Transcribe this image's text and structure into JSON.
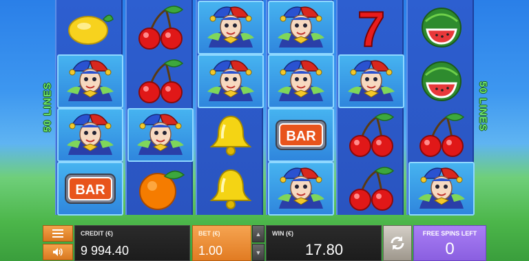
{
  "game": {
    "lines_label": "50 LINES",
    "reels": [
      [
        "lemon",
        "joker",
        "joker",
        "bar"
      ],
      [
        "cherry",
        "cherry",
        "joker",
        "orange"
      ],
      [
        "joker",
        "joker",
        "bell",
        "bell"
      ],
      [
        "joker",
        "joker",
        "bar",
        "joker"
      ],
      [
        "seven",
        "joker",
        "cherry",
        "cherry"
      ],
      [
        "watermelon",
        "watermelon",
        "cherry",
        "joker"
      ]
    ],
    "bar_text": "BAR",
    "seven_text": "7"
  },
  "controls": {
    "menu_icon": "hamburger-icon",
    "sound_icon": "speaker-icon",
    "credit_label": "CREDIT (€)",
    "credit_value": "9 994.40",
    "bet_label": "BET (€)",
    "bet_value": "1.00",
    "win_label": "WIN (€)",
    "win_value": "17.80",
    "spin_icon": "refresh-icon",
    "free_spins_label": "FREE SPINS LEFT",
    "free_spins_value": "0"
  },
  "colors": {
    "sky": "#2a7fe8",
    "grass": "#4cb64a",
    "reel": "#2d5fd0",
    "bet_orange": "#e17b22",
    "free_spins_purple": "#8a5fe0"
  }
}
